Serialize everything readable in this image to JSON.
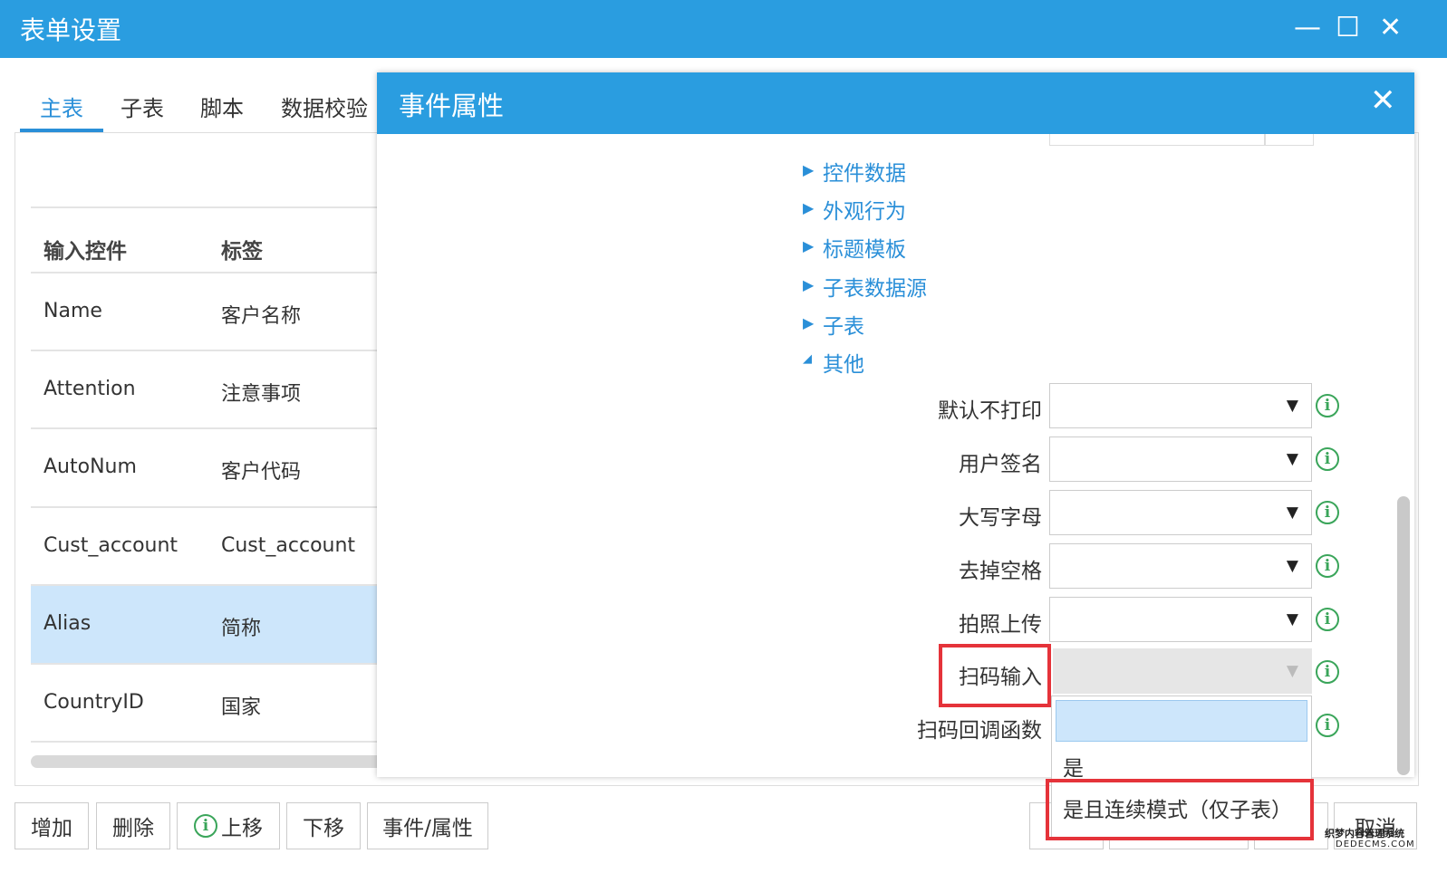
{
  "window": {
    "title": "表单设置",
    "controls": {
      "minimize": "—",
      "maximize": "☐",
      "close": "✕"
    }
  },
  "tabs": [
    {
      "label": "主表",
      "active": true
    },
    {
      "label": "子表"
    },
    {
      "label": "脚本"
    },
    {
      "label": "数据校验"
    }
  ],
  "table": {
    "headers": [
      "输入控件",
      "标签"
    ],
    "rows": [
      {
        "control": "Name",
        "label": "客户名称"
      },
      {
        "control": "Attention",
        "label": "注意事项"
      },
      {
        "control": "AutoNum",
        "label": "客户代码"
      },
      {
        "control": "Cust_account",
        "label": "Cust_account"
      },
      {
        "control": "Alias",
        "label": "简称",
        "selected": true
      },
      {
        "control": "CountryID",
        "label": "国家"
      }
    ]
  },
  "toolbar": {
    "add": "增加",
    "delete": "删除",
    "move_up": "上移",
    "move_down": "下移",
    "event_props": "事件/属性",
    "cancel": "取消"
  },
  "modal": {
    "title": "事件属性",
    "close": "✕",
    "sections": [
      {
        "label": "控件数据",
        "expanded": false
      },
      {
        "label": "外观行为",
        "expanded": false
      },
      {
        "label": "标题模板",
        "expanded": false
      },
      {
        "label": "子表数据源",
        "expanded": false
      },
      {
        "label": "子表",
        "expanded": false
      },
      {
        "label": "其他",
        "expanded": true
      }
    ],
    "fields": [
      {
        "label": "默认不打印",
        "value": ""
      },
      {
        "label": "用户签名",
        "value": ""
      },
      {
        "label": "大写字母",
        "value": ""
      },
      {
        "label": "去掉空格",
        "value": ""
      },
      {
        "label": "拍照上传",
        "value": ""
      },
      {
        "label": "扫码输入",
        "value": "",
        "disabled": true,
        "highlighted": true
      },
      {
        "label": "扫码回调函数",
        "value": ""
      }
    ],
    "dropdown_options": [
      {
        "label": "",
        "highlighted": true
      },
      {
        "label": "是"
      },
      {
        "label": "是且连续模式（仅子表）",
        "boxed": true
      }
    ]
  },
  "icons": {
    "info": "i",
    "expand": "▶",
    "collapse": "◢",
    "arrow": "▼"
  },
  "watermark": {
    "line1": "织梦内容管理系统",
    "line2": "DEDECMS.COM"
  },
  "colors": {
    "accent": "#2a9de0",
    "link": "#2a8fd8",
    "selected_row": "#cde6fb",
    "highlight_box": "#e5333a",
    "info": "#3aa55a"
  }
}
